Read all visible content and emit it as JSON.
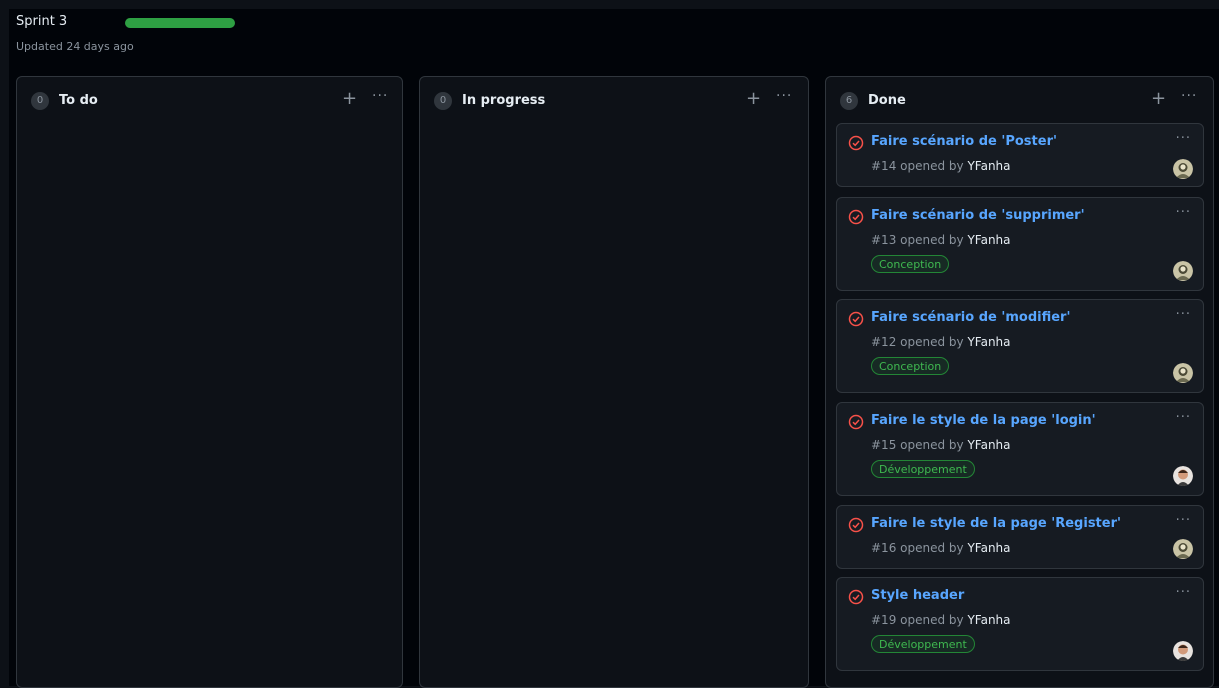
{
  "project": {
    "title": "Sprint 3",
    "updated": "Updated 24 days ago",
    "accent_color": "#2ea043"
  },
  "columns": [
    {
      "name": "To do",
      "count": "0",
      "add_icon": "plus-icon",
      "more_icon": "kebab-icon"
    },
    {
      "name": "In progress",
      "count": "0",
      "add_icon": "plus-icon",
      "more_icon": "kebab-icon"
    },
    {
      "name": "Done",
      "count": "6",
      "add_icon": "plus-icon",
      "more_icon": "kebab-icon"
    }
  ],
  "cards": [
    {
      "title": "Faire scénario de 'Poster'",
      "number": "#14",
      "opened_by": "opened by",
      "author": "YFanha",
      "label": "",
      "avatar": "avatar-a"
    },
    {
      "title": "Faire scénario de 'supprimer'",
      "number": "#13",
      "opened_by": "opened by",
      "author": "YFanha",
      "label": "Conception",
      "avatar": "avatar-a"
    },
    {
      "title": "Faire scénario de 'modifier'",
      "number": "#12",
      "opened_by": "opened by",
      "author": "YFanha",
      "label": "Conception",
      "avatar": "avatar-a"
    },
    {
      "title": "Faire le style de la page 'login'",
      "number": "#15",
      "opened_by": "opened by",
      "author": "YFanha",
      "label": "Développement",
      "avatar": "avatar-b"
    },
    {
      "title": "Faire le style de la page 'Register'",
      "number": "#16",
      "opened_by": "opened by",
      "author": "YFanha",
      "label": "",
      "avatar": "avatar-a"
    },
    {
      "title": "Style header",
      "number": "#19",
      "opened_by": "opened by",
      "author": "YFanha",
      "label": "Développement",
      "avatar": "avatar-b"
    }
  ],
  "colors": {
    "closed_issue_icon": "#f85149",
    "label_green": "#3fb950"
  }
}
